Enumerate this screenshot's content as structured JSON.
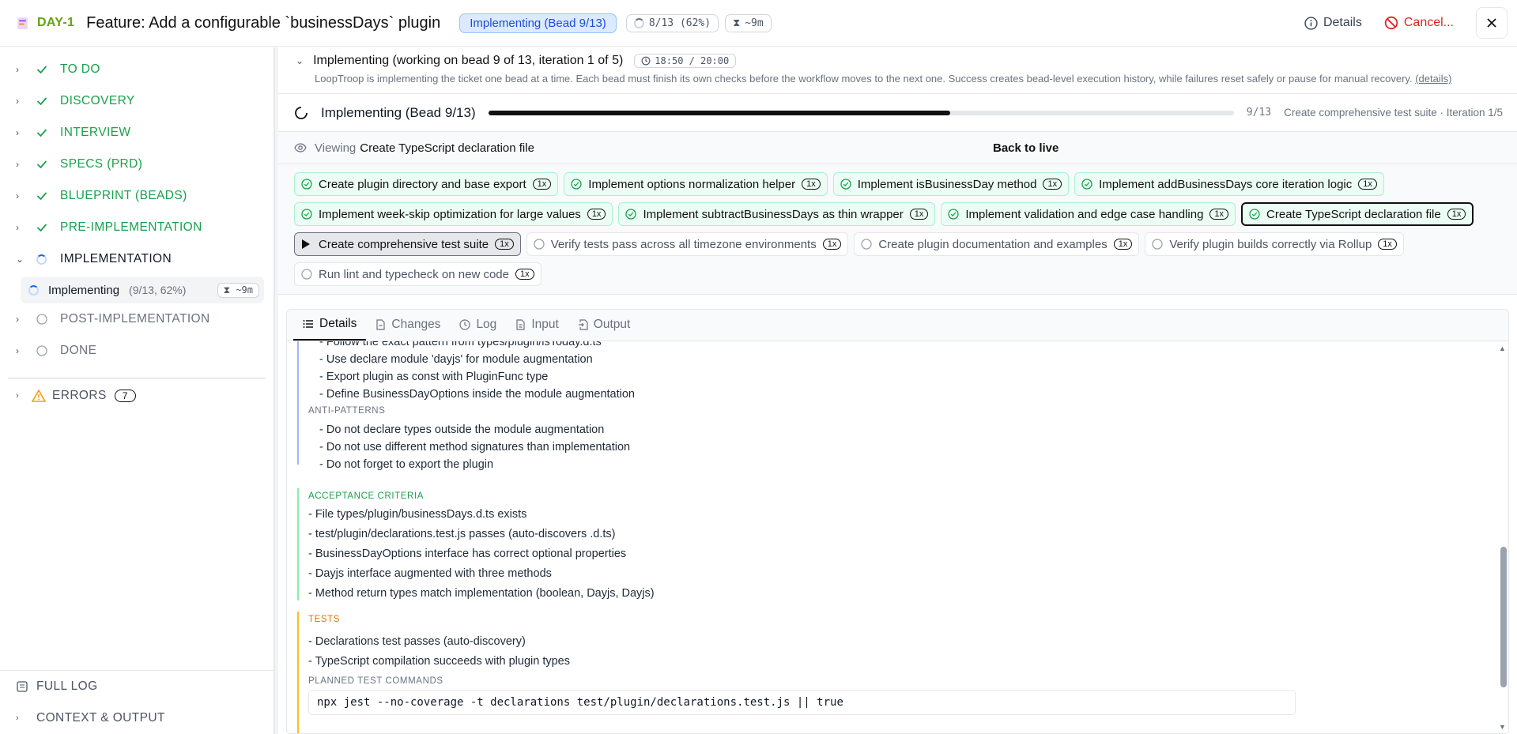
{
  "header": {
    "ticket_id": "DAY-1",
    "title": "Feature: Add a configurable `businessDays` plugin",
    "status_pill": "Implementing (Bead 9/13)",
    "progress_chip": "8/13 (62%)",
    "eta_chip": "~9m",
    "details_label": "Details",
    "cancel_label": "Cancel..."
  },
  "sidebar": {
    "phases": [
      {
        "label": "TO DO",
        "state": "done"
      },
      {
        "label": "DISCOVERY",
        "state": "done"
      },
      {
        "label": "INTERVIEW",
        "state": "done"
      },
      {
        "label": "SPECS (PRD)",
        "state": "done"
      },
      {
        "label": "BLUEPRINT (BEADS)",
        "state": "done"
      },
      {
        "label": "PRE-IMPLEMENTATION",
        "state": "done"
      },
      {
        "label": "IMPLEMENTATION",
        "state": "active"
      }
    ],
    "sub_item": {
      "label": "Implementing",
      "meta": "(9/13, 62%)",
      "eta": "~9m"
    },
    "later_phases": [
      {
        "label": "POST-IMPLEMENTATION",
        "state": "pending"
      },
      {
        "label": "DONE",
        "state": "pending"
      }
    ],
    "errors": {
      "label": "ERRORS",
      "count": "7"
    },
    "full_log": "FULL LOG",
    "context_output": "CONTEXT & OUTPUT"
  },
  "phase_header": {
    "title": "Implementing (working on bead 9 of 13, iteration 1 of 5)",
    "time": "18:50 / 20:00",
    "description": "LoopTroop is implementing the ticket one bead at a time. Each bead must finish its own checks before the workflow moves to the next one. Success creates bead-level execution history, while failures reset safely or pause for manual recovery.",
    "details_link": "(details)"
  },
  "progress": {
    "title": "Implementing (Bead 9/13)",
    "fraction": 0.62,
    "count": "9/13",
    "iteration_text": "Create comprehensive test suite · Iteration 1/5"
  },
  "viewing": {
    "label": "Viewing",
    "value": "Create TypeScript declaration file",
    "back": "Back to live"
  },
  "beads": [
    {
      "label": "Create plugin directory and base export",
      "state": "done",
      "count": "1x"
    },
    {
      "label": "Implement options normalization helper",
      "state": "done",
      "count": "1x"
    },
    {
      "label": "Implement isBusinessDay method",
      "state": "done",
      "count": "1x"
    },
    {
      "label": "Implement addBusinessDays core iteration logic",
      "state": "done",
      "count": "1x"
    },
    {
      "label": "Implement week-skip optimization for large values",
      "state": "done",
      "count": "1x"
    },
    {
      "label": "Implement subtractBusinessDays as thin wrapper",
      "state": "done",
      "count": "1x"
    },
    {
      "label": "Implement validation and edge case handling",
      "state": "done",
      "count": "1x"
    },
    {
      "label": "Create TypeScript declaration file",
      "state": "selected",
      "count": "1x"
    },
    {
      "label": "Create comprehensive test suite",
      "state": "current",
      "count": "1x"
    },
    {
      "label": "Verify tests pass across all timezone environments",
      "state": "pending",
      "count": "1x"
    },
    {
      "label": "Create plugin documentation and examples",
      "state": "pending",
      "count": "1x"
    },
    {
      "label": "Verify plugin builds correctly via Rollup",
      "state": "pending",
      "count": "1x"
    },
    {
      "label": "Run lint and typecheck on new code",
      "state": "pending",
      "count": "1x"
    }
  ],
  "tabs": [
    {
      "label": "Details",
      "icon": "list-icon"
    },
    {
      "label": "Changes",
      "icon": "file-diff-icon"
    },
    {
      "label": "Log",
      "icon": "log-icon"
    },
    {
      "label": "Input",
      "icon": "file-input-icon"
    },
    {
      "label": "Output",
      "icon": "file-output-icon"
    }
  ],
  "details": {
    "guidance_items": [
      "- Follow the exact pattern from types/plugin/isToday.d.ts",
      "- Use declare module 'dayjs' for module augmentation",
      "- Export plugin as const with PluginFunc type",
      "- Define BusinessDayOptions inside the module augmentation"
    ],
    "anti_patterns_label": "ANTI-PATTERNS",
    "anti_patterns": [
      "- Do not declare types outside the module augmentation",
      "- Do not use different method signatures than implementation",
      "- Do not forget to export the plugin"
    ],
    "acceptance_label": "ACCEPTANCE CRITERIA",
    "acceptance": [
      "- File types/plugin/businessDays.d.ts exists",
      "- test/plugin/declarations.test.js passes (auto-discovers .d.ts)",
      "- BusinessDayOptions interface has correct optional properties",
      "- Dayjs interface augmented with three methods",
      "- Method return types match implementation (boolean, Dayjs, Dayjs)"
    ],
    "tests_label": "TESTS",
    "tests": [
      "- Declarations test passes (auto-discovery)",
      "- TypeScript compilation succeeds with plugin types"
    ],
    "planned_label": "PLANNED TEST COMMANDS",
    "command": "npx jest --no-coverage -t declarations test/plugin/declarations.test.js || true"
  },
  "colors": {
    "done": "#16a34a",
    "accent": "#1d4ed8",
    "danger": "#dc2626",
    "warning": "#d97706"
  }
}
